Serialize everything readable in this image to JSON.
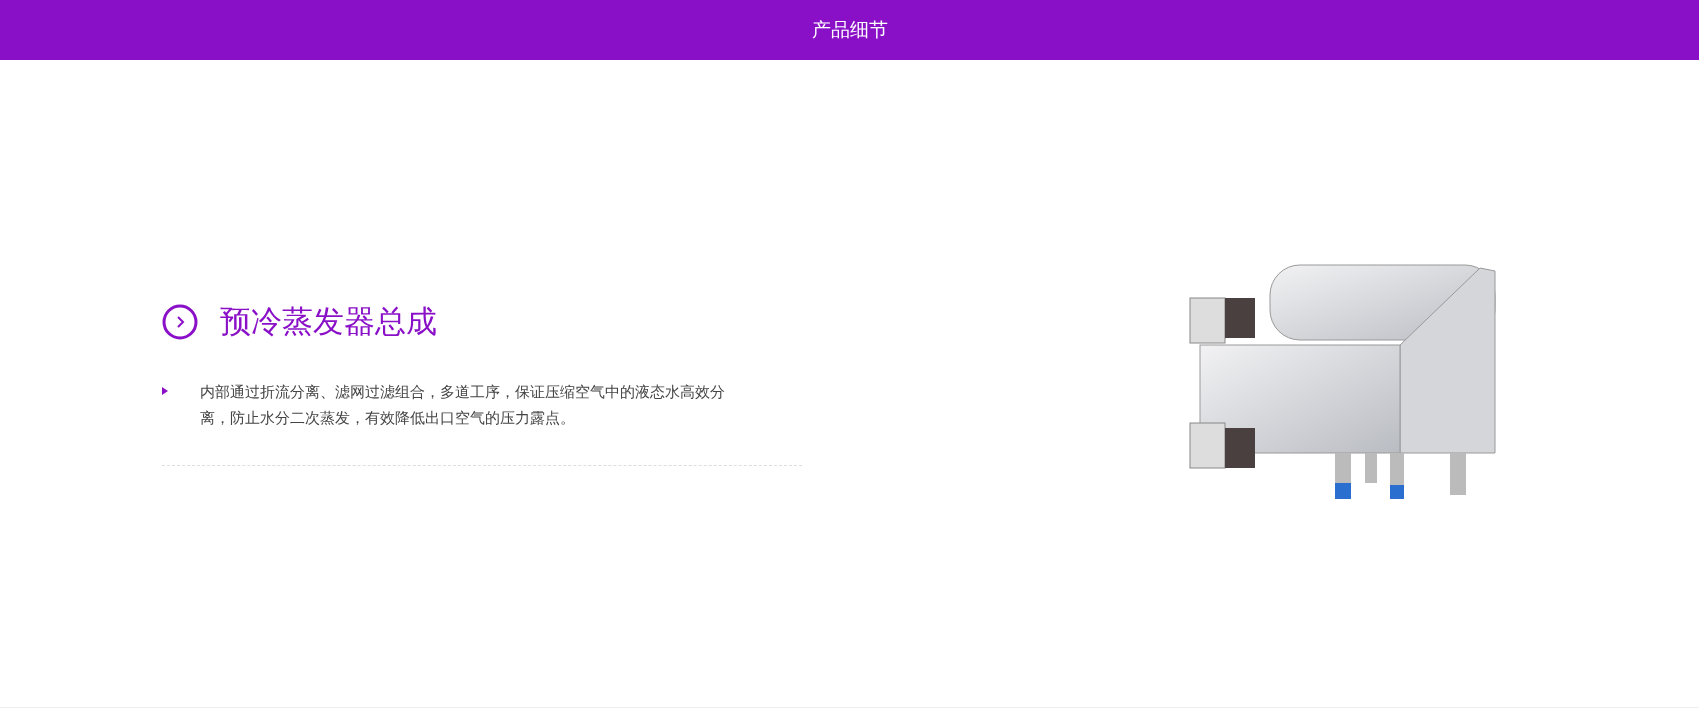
{
  "header": {
    "title": "产品细节"
  },
  "section": {
    "heading": "预冷蒸发器总成",
    "bullets": [
      "内部通过折流分离、滤网过滤组合，多道工序，保证压缩空气中的液态水高效分离，防止水分二次蒸发，有效降低出口空气的压力露点。"
    ]
  }
}
